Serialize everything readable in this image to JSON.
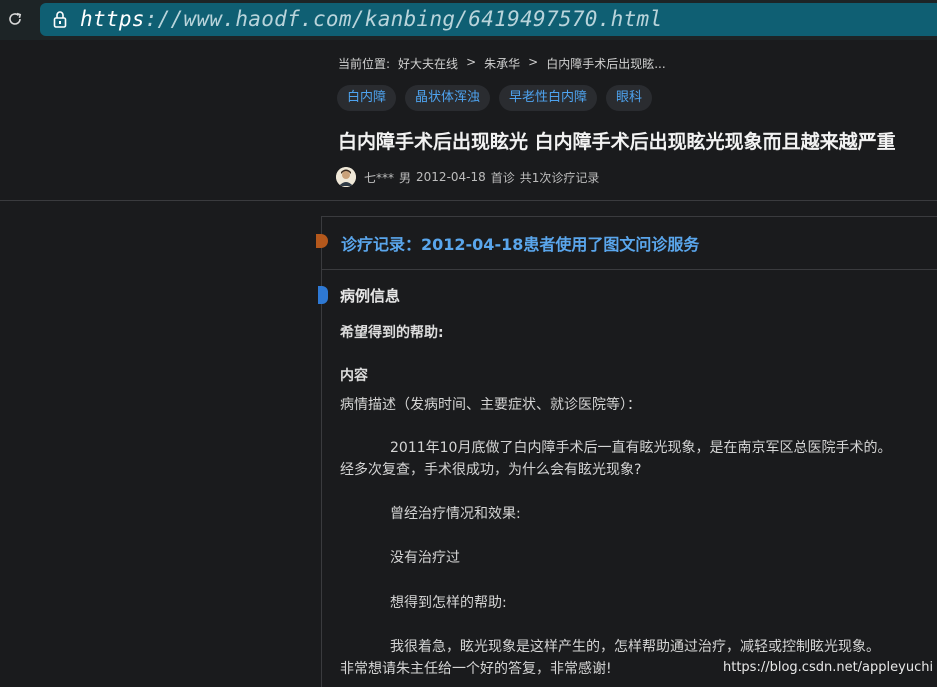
{
  "browser": {
    "url_scheme": "https",
    "url_rest": "://www.haodf.com/kanbing/6419497570.html"
  },
  "breadcrumb": {
    "prefix": "当前位置:",
    "items": [
      "好大夫在线",
      "朱承华",
      "白内障手术后出现眩..."
    ],
    "separator": ">"
  },
  "tags": [
    "白内障",
    "晶状体浑浊",
    "早老性白内障",
    "眼科"
  ],
  "page": {
    "title": "白内障手术后出现眩光 白内障手术后出现眩光现象而且越来越严重"
  },
  "meta": {
    "patient": "七***",
    "gender": "男",
    "date": "2012-04-18",
    "visit_type": "首诊",
    "record_count": "共1次诊疗记录"
  },
  "record": {
    "title": "诊疗记录：2012-04-18患者使用了图文问诊服务",
    "section_title": "病例信息",
    "help_label": "希望得到的帮助:",
    "content_label": "内容",
    "desc_label": "病情描述（发病时间、主要症状、就诊医院等）：",
    "para1_line1": "2011年10月底做了白内障手术后一直有眩光现象，是在南京军区总医院手术的。",
    "para1_line2": "经多次复查，手术很成功，为什么会有眩光现象?",
    "treatment_label": "曾经治疗情况和效果:",
    "treatment_value": "没有治疗过",
    "wish_label": "想得到怎样的帮助:",
    "wish_line1": "我很着急，眩光现象是这样产生的，怎样帮助通过治疗，减轻或控制眩光现象。",
    "wish_line2": "非常想请朱主任给一个好的答复，非常感谢!"
  },
  "watermark": "https://blog.csdn.net/appleyuchi",
  "colors": {
    "accent_blue": "#5aa6ec",
    "tag_text": "#4ea3ef",
    "url_bar": "#0f5f73",
    "record_marker": "#b4581c",
    "section_marker": "#2e79d4"
  }
}
